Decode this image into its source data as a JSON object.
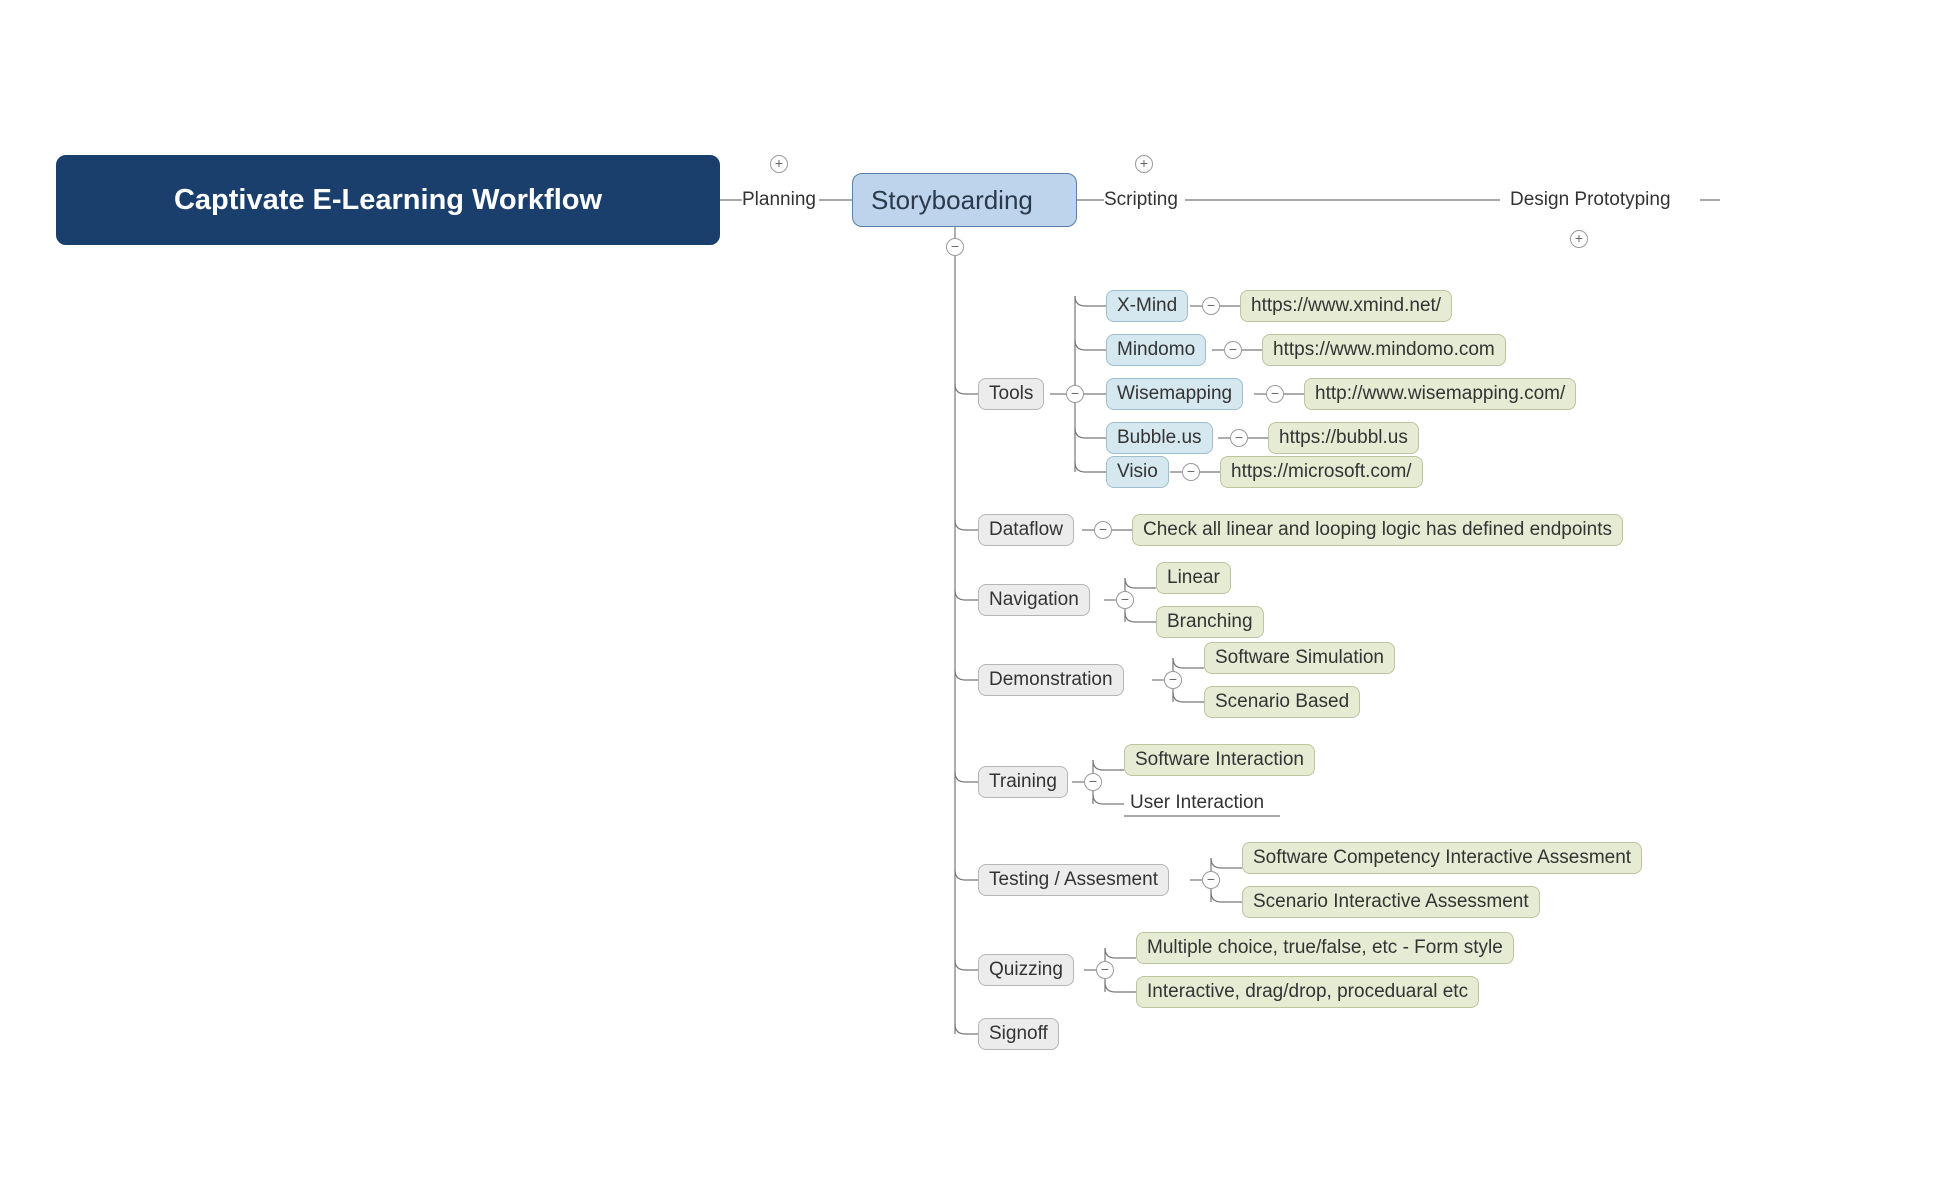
{
  "root": {
    "title": "Captivate E-Learning Workflow"
  },
  "stages": {
    "planning": "Planning",
    "storyboarding": "Storyboarding",
    "scripting": "Scripting",
    "design_prototyping": "Design Prototyping"
  },
  "storyboarding": {
    "tools": {
      "label": "Tools",
      "items": {
        "xmind": {
          "name": "X-Mind",
          "url": "https://www.xmind.net/"
        },
        "mindomo": {
          "name": "Mindomo",
          "url": "https://www.mindomo.com"
        },
        "wisemapping": {
          "name": "Wisemapping",
          "url": "http://www.wisemapping.com/"
        },
        "bubbleus": {
          "name": "Bubble.us",
          "url": "https://bubbl.us"
        },
        "visio": {
          "name": "Visio",
          "url": "https://microsoft.com/"
        }
      }
    },
    "dataflow": {
      "label": "Dataflow",
      "note": "Check all linear and looping logic has defined endpoints"
    },
    "navigation": {
      "label": "Navigation",
      "items": {
        "linear": "Linear",
        "branching": "Branching"
      }
    },
    "demonstration": {
      "label": "Demonstration",
      "items": {
        "software_sim": "Software Simulation",
        "scenario": "Scenario Based"
      }
    },
    "training": {
      "label": "Training",
      "items": {
        "software_interaction": "Software Interaction",
        "user_interaction": "User Interaction"
      }
    },
    "testing": {
      "label": "Testing / Assesment",
      "items": {
        "competency": "Software Competency Interactive Assesment",
        "scenario": "Scenario Interactive Assessment"
      }
    },
    "quizzing": {
      "label": "Quizzing",
      "items": {
        "forms": "Multiple choice, true/false, etc - Form style",
        "interactive": "Interactive, drag/drop, proceduaral etc"
      }
    },
    "signoff": {
      "label": "Signoff"
    }
  }
}
